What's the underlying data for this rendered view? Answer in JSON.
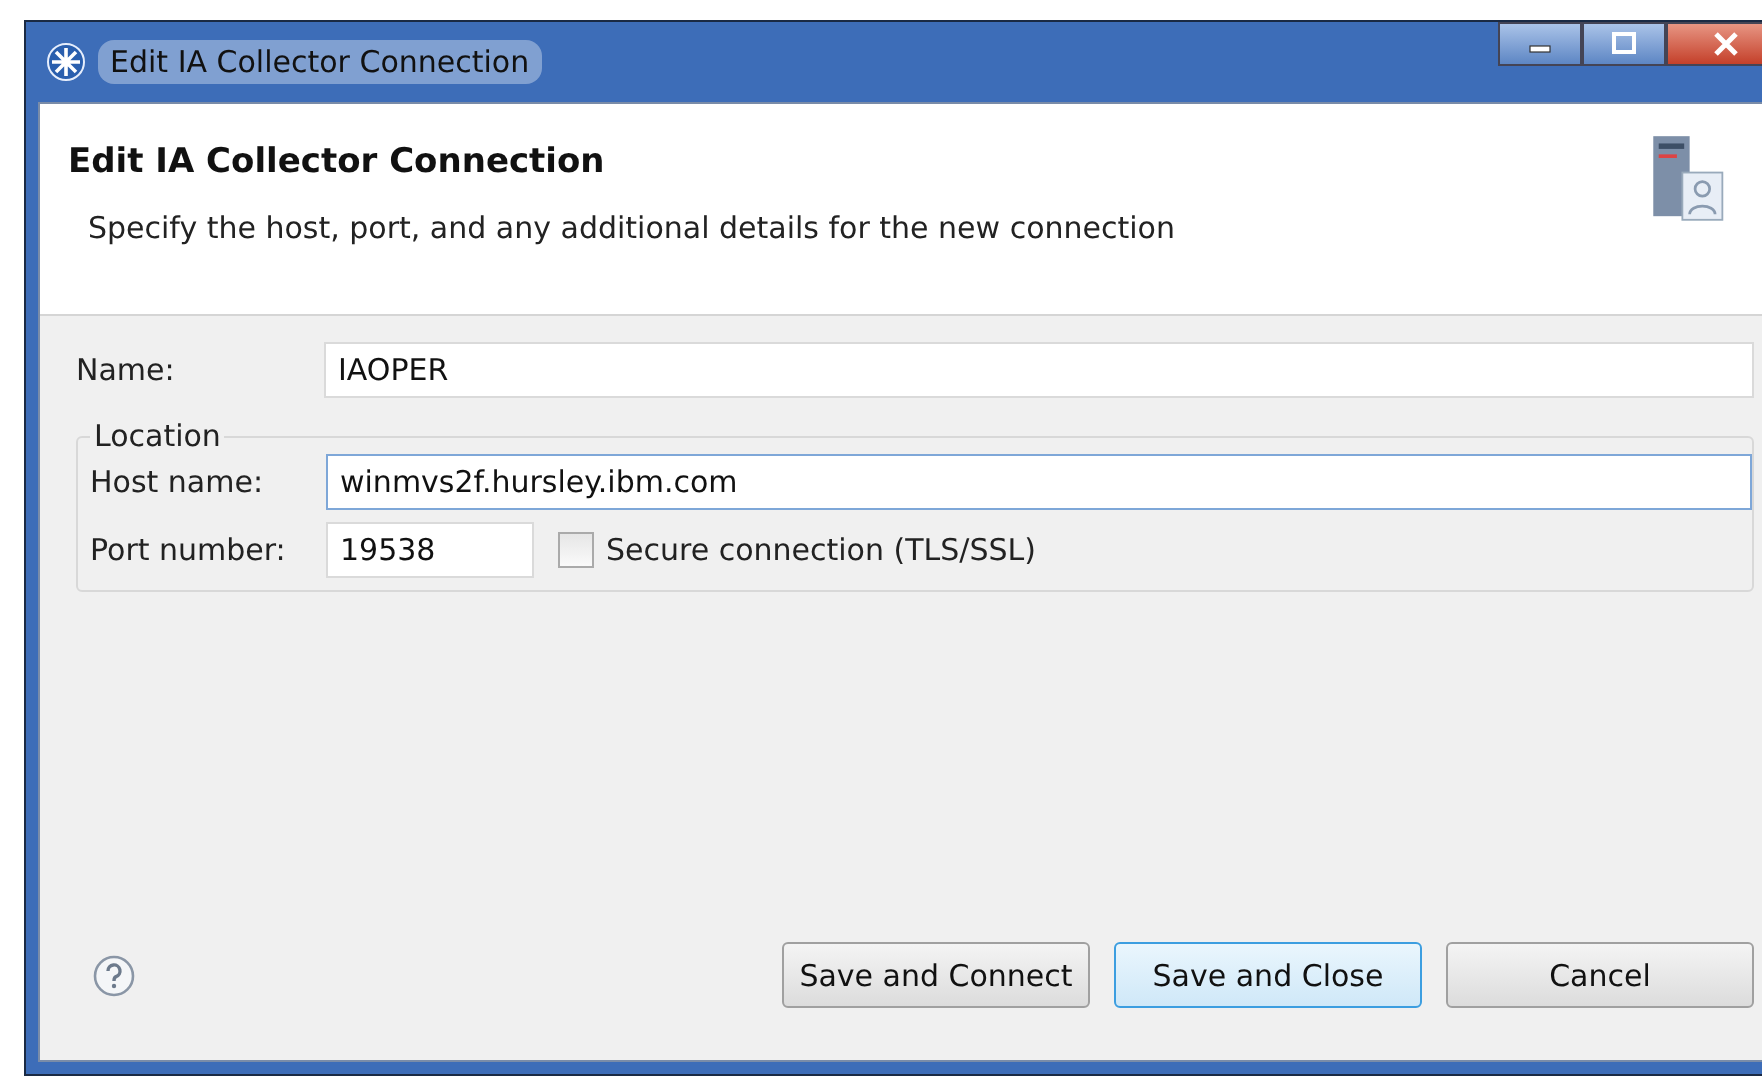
{
  "window": {
    "title": "Edit IA Collector Connection"
  },
  "header": {
    "title": "Edit IA Collector Connection",
    "description": "Specify the host, port, and any additional details for the new connection"
  },
  "name_field": {
    "label": "Name:",
    "value": "IAOPER"
  },
  "location": {
    "legend": "Location",
    "host": {
      "label": "Host name:",
      "value": "winmvs2f.hursley.ibm.com"
    },
    "port": {
      "label": "Port number:",
      "value": "19538"
    },
    "secure": {
      "label": "Secure connection (TLS/SSL)",
      "checked": false
    }
  },
  "buttons": [
    {
      "label": "Save and Connect",
      "focused": false
    },
    {
      "label": "Save and Close",
      "focused": true
    },
    {
      "label": "Cancel",
      "focused": false
    }
  ]
}
